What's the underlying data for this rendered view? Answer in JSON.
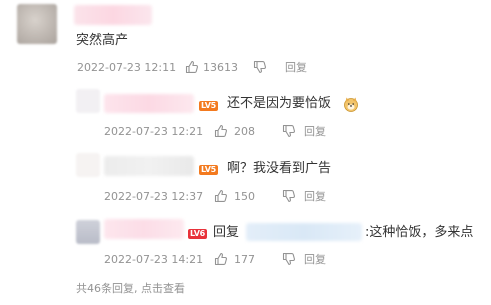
{
  "main_comment": {
    "text": "突然高产",
    "time": "2022-07-23 12:11",
    "likes": "13613",
    "reply_label": "回复"
  },
  "replies": [
    {
      "text": "还不是因为要恰饭",
      "level": "LV5",
      "time": "2022-07-23 12:21",
      "likes": "208",
      "reply_label": "回复",
      "emoji": "doge-emoji"
    },
    {
      "text": "啊？我没看到广告",
      "level": "LV5",
      "time": "2022-07-23 12:37",
      "likes": "150",
      "reply_label": "回复"
    },
    {
      "prefix": "回复",
      "text": ":这种恰饭，多来点",
      "level": "LV6",
      "time": "2022-07-23 14:21",
      "likes": "177",
      "reply_label": "回复"
    }
  ],
  "footer": {
    "text": "共46条回复, 点击查看"
  },
  "colors": {
    "meta_gray": "#939393",
    "badge_orange": "#f37a1f",
    "badge_red": "#e8323a"
  }
}
